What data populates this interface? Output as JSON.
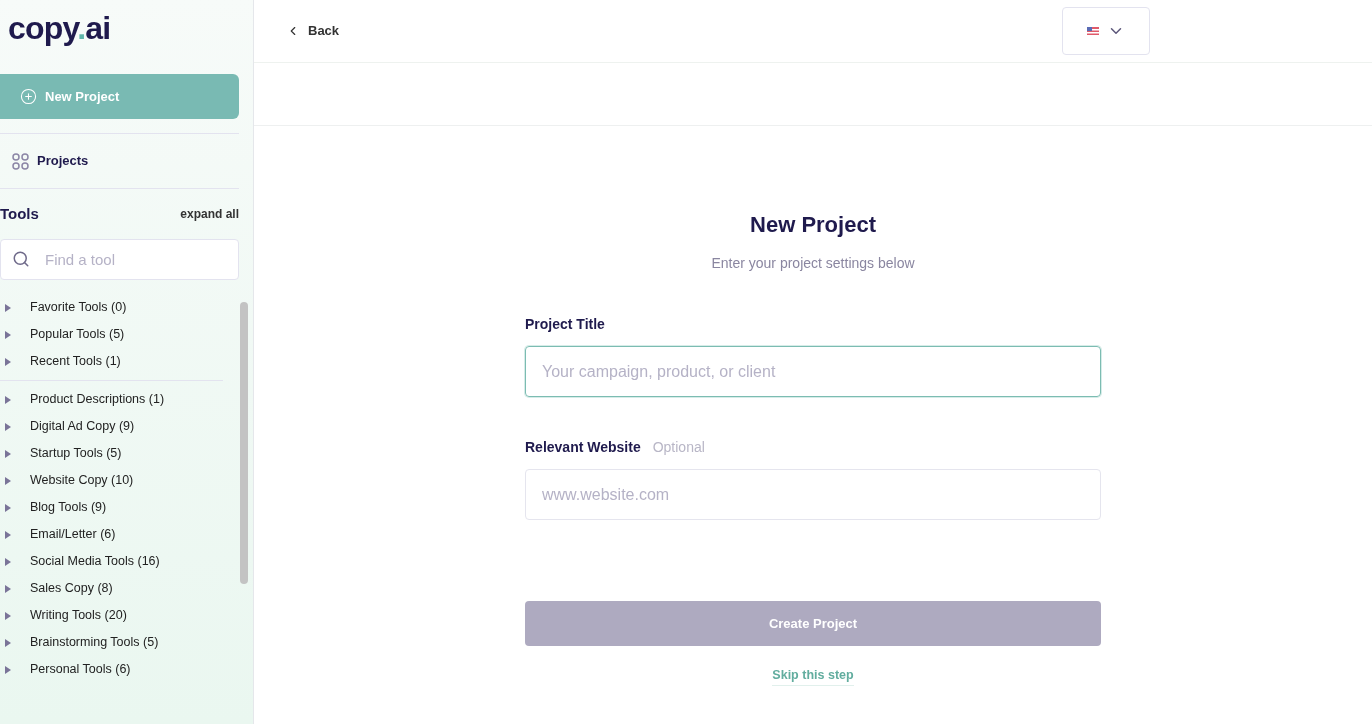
{
  "logo": {
    "name": "copy",
    "dot": ".",
    "suffix": "ai"
  },
  "sidebar": {
    "new_project": "New Project",
    "projects": "Projects",
    "tools_heading": "Tools",
    "expand_all": "expand all",
    "search": {
      "placeholder": "Find a tool"
    },
    "groups": [
      [
        {
          "label": "Favorite Tools (0)",
          "expanded": false
        },
        {
          "label": "Popular Tools (5)",
          "expanded": false
        },
        {
          "label": "Recent Tools (1)",
          "expanded": false
        }
      ],
      [
        {
          "label": "Product Descriptions (1)",
          "expanded": false
        },
        {
          "label": "Digital Ad Copy (9)",
          "expanded": false
        },
        {
          "label": "Startup Tools (5)",
          "expanded": false
        },
        {
          "label": "Website Copy (10)",
          "expanded": false
        },
        {
          "label": "Blog Tools (9)",
          "expanded": false
        },
        {
          "label": "Email/Letter (6)",
          "expanded": false
        },
        {
          "label": "Social Media Tools (16)",
          "expanded": false
        },
        {
          "label": "Sales Copy (8)",
          "expanded": false
        },
        {
          "label": "Writing Tools (20)",
          "expanded": false
        },
        {
          "label": "Brainstorming Tools (5)",
          "expanded": false
        },
        {
          "label": "Personal Tools (6)",
          "expanded": false
        }
      ]
    ]
  },
  "topbar": {
    "back": "Back"
  },
  "form": {
    "title": "New Project",
    "subtitle": "Enter your project settings below",
    "fields": [
      {
        "label": "Project Title",
        "placeholder": "Your campaign, product, or client",
        "focused": true
      },
      {
        "label": "Relevant Website",
        "note": "Optional",
        "placeholder": "www.website.com",
        "focused": false
      }
    ],
    "submit": {
      "label": "Create Project",
      "disabled": true
    },
    "skip": "Skip this step"
  }
}
